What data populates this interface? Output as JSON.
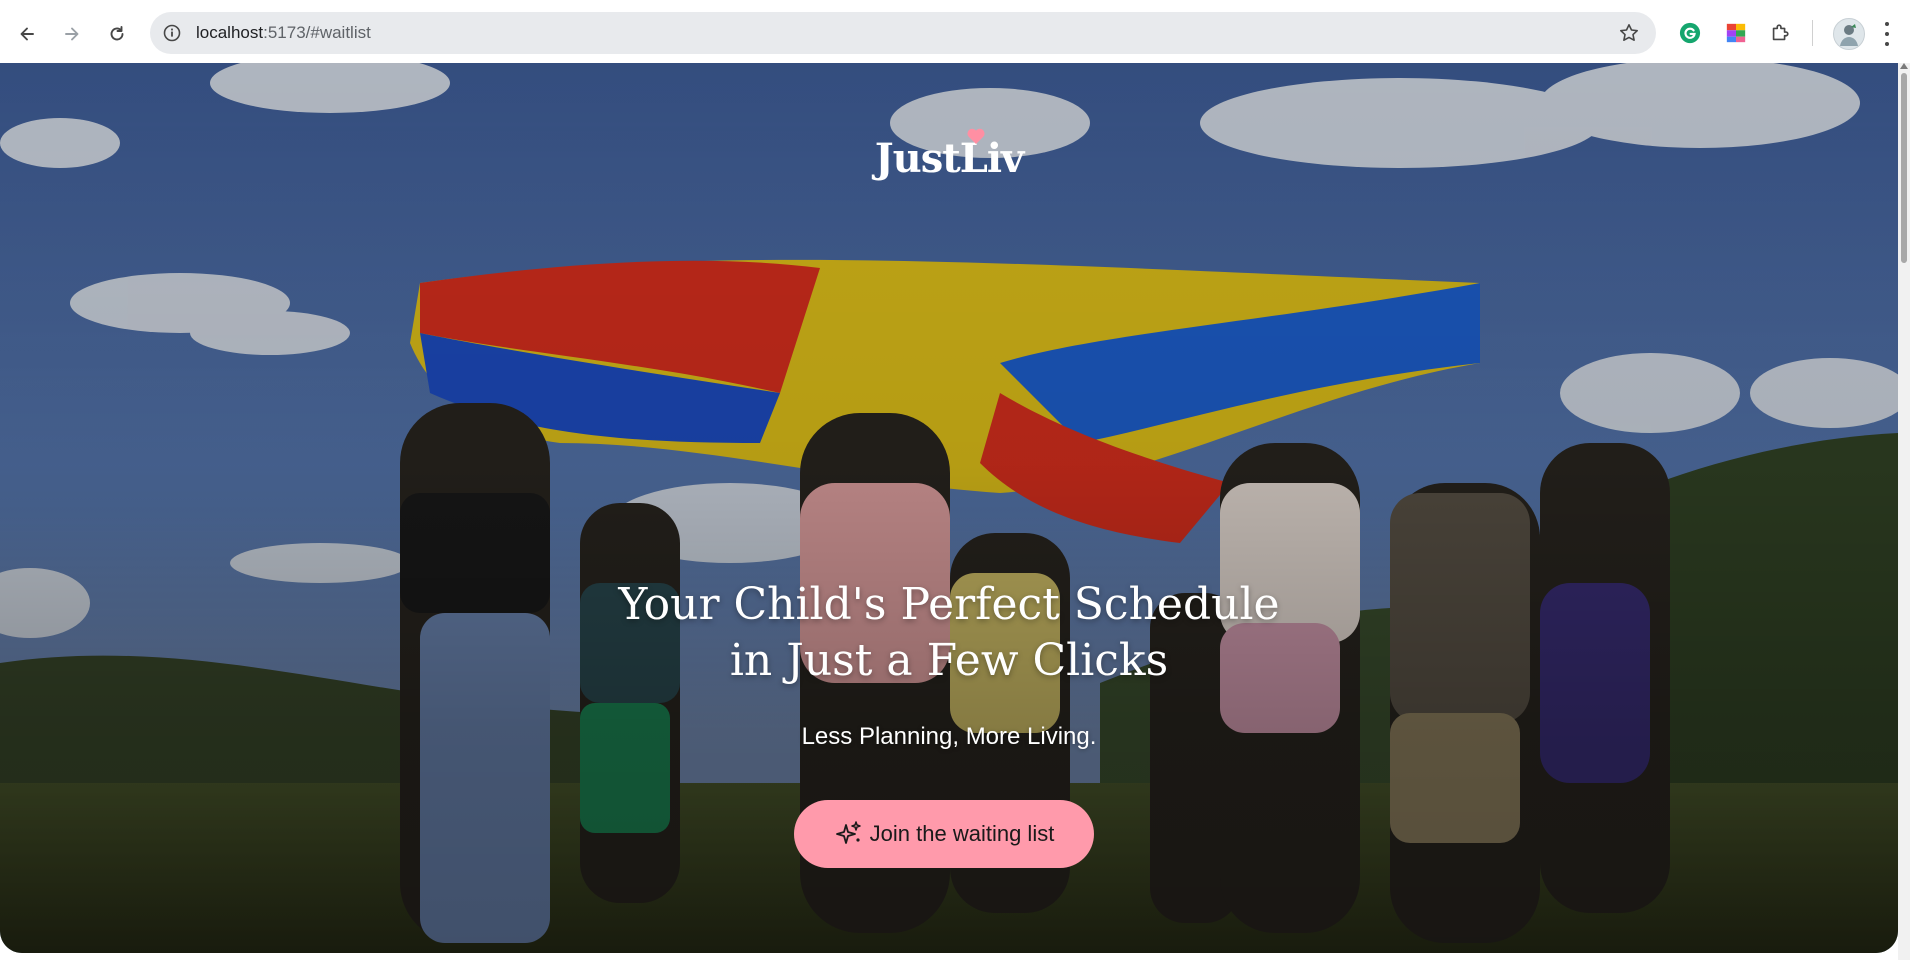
{
  "browser": {
    "url_host": "localhost",
    "url_path": ":5173/#waitlist",
    "icons": [
      "back-arrow-icon",
      "forward-arrow-icon",
      "reload-icon",
      "site-info-icon",
      "bookmark-star-icon",
      "grammarly-icon",
      "color-palette-icon",
      "extensions-puzzle-icon",
      "profile-avatar",
      "more-menu-icon"
    ]
  },
  "hero": {
    "logo_text": "JustLiv",
    "headline_line1": "Your Child's Perfect Schedule",
    "headline_line2": "in Just a Few Clicks",
    "subheadline": "Less Planning, More Living.",
    "cta_label": "Join the waiting list",
    "cta_icon": "sparkles-icon"
  },
  "colors": {
    "cta_background": "#ff9aab",
    "logo_heart": "#ff8fa3",
    "text_on_hero": "#ffffff"
  }
}
